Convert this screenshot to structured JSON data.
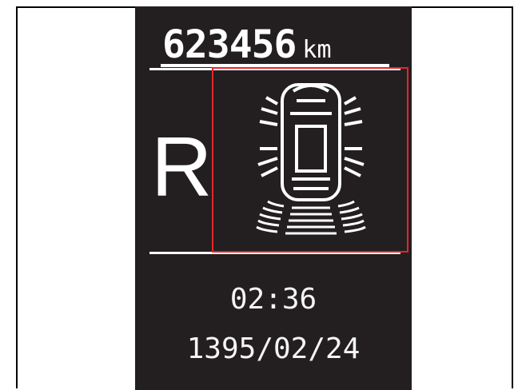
{
  "odometer": {
    "value": "623456",
    "unit": "km"
  },
  "gear": "R",
  "clock": "02:36",
  "date": "1395/02/24",
  "icons": {
    "parking_assist": "car-top-view-with-rear-sensor-waves-icon"
  },
  "colors": {
    "screen_bg": "#231f20",
    "foreground": "#ffffff",
    "highlight_border": "#e3262d"
  }
}
